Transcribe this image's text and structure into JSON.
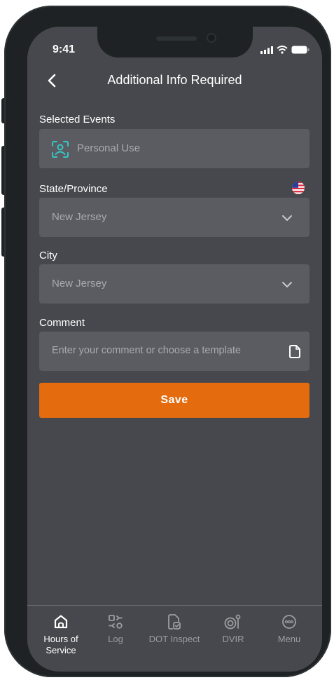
{
  "status_bar": {
    "time": "9:41"
  },
  "header": {
    "title": "Additional Info Required"
  },
  "form": {
    "selected_events": {
      "label": "Selected Events",
      "value": "Personal Use"
    },
    "state": {
      "label": "State/Province",
      "value": "New Jersey"
    },
    "city": {
      "label": "City",
      "value": "New Jersey"
    },
    "comment": {
      "label": "Comment",
      "placeholder": "Enter your comment or choose a template"
    }
  },
  "save_label": "Save",
  "tabs": [
    {
      "label": "Hours of Service",
      "active": true
    },
    {
      "label": "Log",
      "active": false
    },
    {
      "label": "DOT Inspect",
      "active": false
    },
    {
      "label": "DVIR",
      "active": false
    },
    {
      "label": "Menu",
      "active": false
    }
  ],
  "colors": {
    "accent": "#e56c0e",
    "icon_teal": "#35c7c2",
    "background": "#47484d",
    "field": "#5b5c62"
  }
}
